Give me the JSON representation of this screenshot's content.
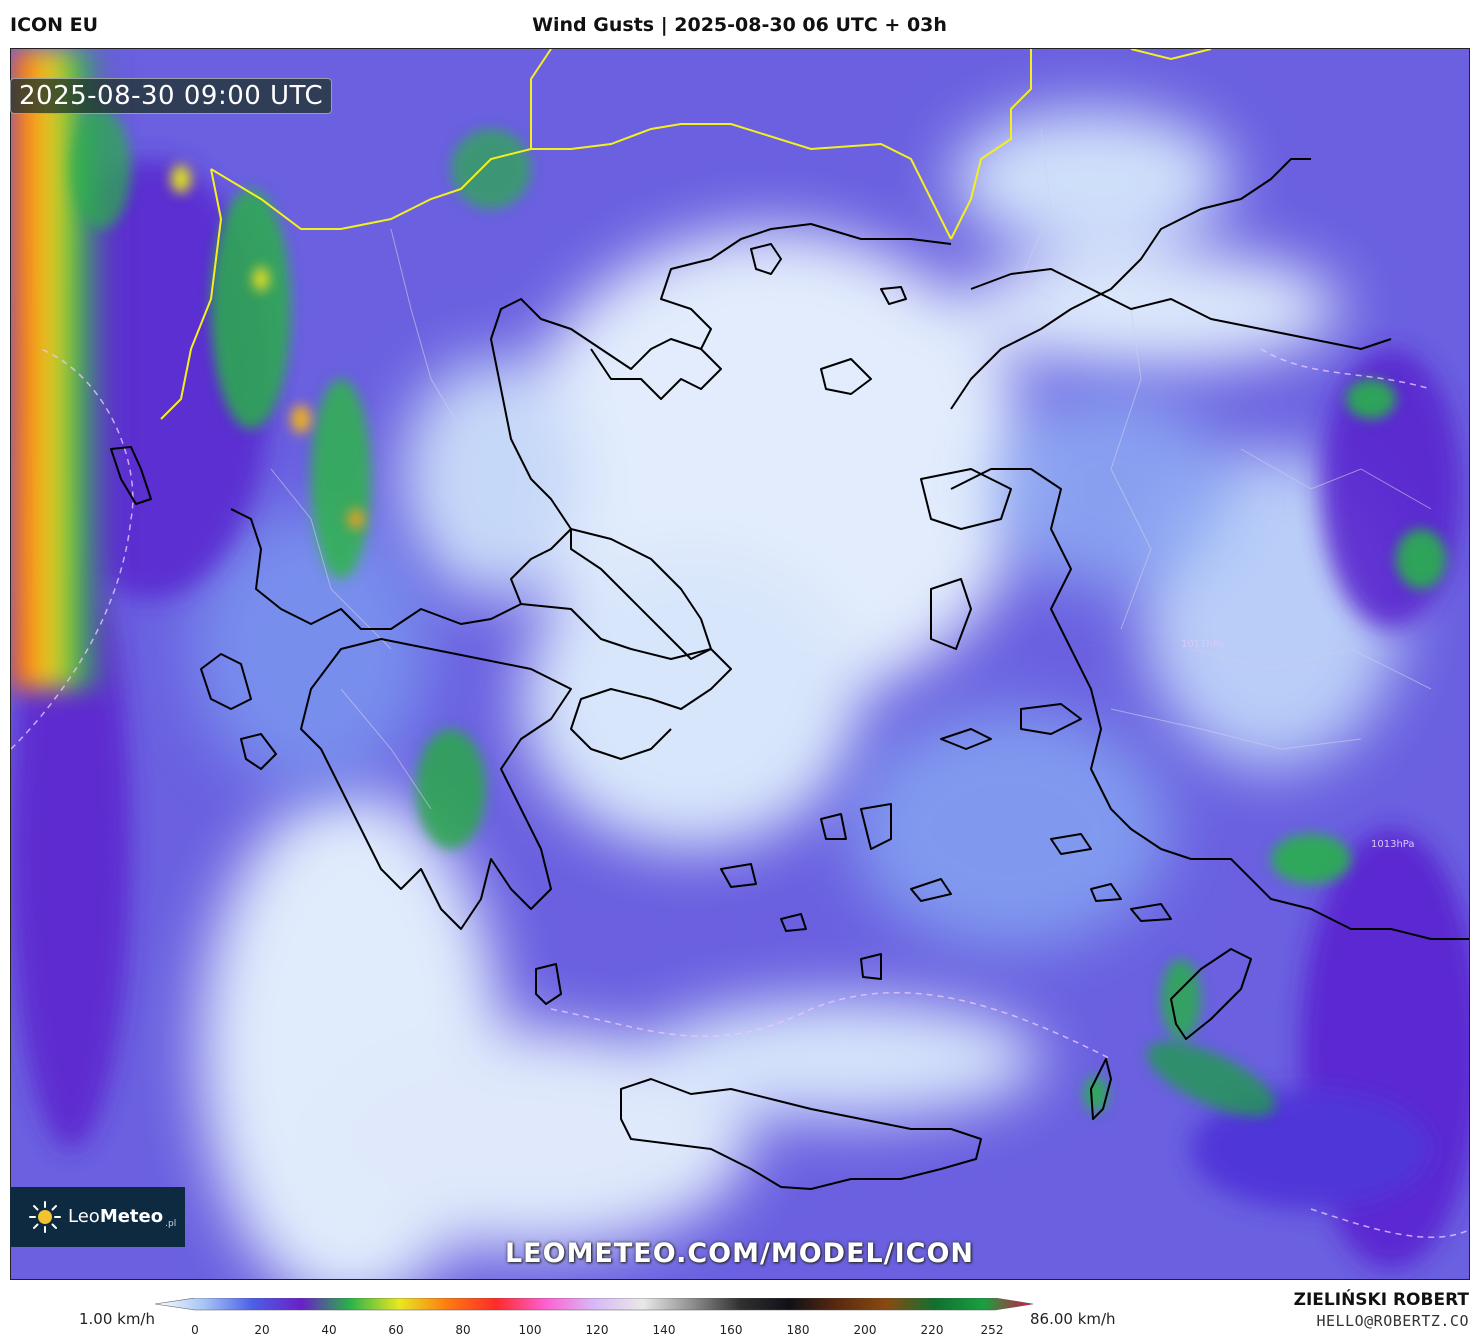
{
  "header": {
    "model": "ICON EU",
    "title": "Wind Gusts | 2025-08-30 06 UTC + 03h"
  },
  "map": {
    "valid_time": "2025-08-30 09:00 UTC",
    "isobar_labels": [
      "1011hPa",
      "1013hPa"
    ],
    "colors": {
      "sea_calm": "#dde9fb",
      "low": "#7fa6f2",
      "medium_low": "#4b55e6",
      "medium": "#6a1fc9",
      "strong": "#28b64a",
      "very_strong": "#e4e020",
      "extreme": "#ff5a1a",
      "coastline": "#000000",
      "border_country": "#ffff33",
      "border_region": "#c8c8c8"
    }
  },
  "watermark": "LEOMETEO.COM/MODEL/ICON",
  "logo": {
    "name_light": "Leo",
    "name_bold": "Meteo",
    "suffix": ".pl"
  },
  "legend": {
    "min_label": "1.00 km/h",
    "max_label": "86.00 km/h",
    "ticks": [
      "0",
      "20",
      "40",
      "60",
      "80",
      "100",
      "120",
      "140",
      "160",
      "180",
      "200",
      "220",
      "252"
    ],
    "gradient": [
      "#ffffff",
      "#a6c4f6",
      "#4c5fe8",
      "#6a1fc9",
      "#29b34a",
      "#e8e820",
      "#ff7a10",
      "#ff2a2a",
      "#ff5fd0",
      "#d8b8f8",
      "#e8e8e8",
      "#909090",
      "#303030",
      "#101018",
      "#5a2a10",
      "#8a4a10",
      "#107030",
      "#18a040",
      "#e01040"
    ]
  },
  "credits": {
    "author": "ZIELIŃSKI ROBERT",
    "email": "HELLO@ROBERTZ.CO"
  }
}
